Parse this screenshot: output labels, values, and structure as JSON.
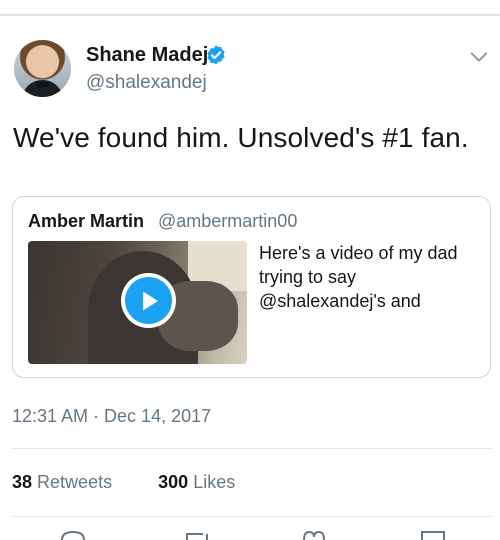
{
  "tweet": {
    "author": {
      "name": "Shane Madej",
      "handle": "@shalexandej",
      "verified": true
    },
    "text": "We've found him. Unsolved's #1 fan.",
    "quoted_tweet": {
      "author_name": "Amber Martin",
      "author_handle": "@ambermartin00",
      "text_lines": [
        "Here's a video of my dad",
        "trying to say",
        "@shalexandej's and"
      ],
      "media": "video"
    },
    "timestamp": "12:31 AM · Dec 14, 2017",
    "stats": {
      "retweets_count": "38",
      "retweets_label": "Retweets",
      "likes_count": "300",
      "likes_label": "Likes"
    }
  },
  "icons": {
    "verified": "verified-badge-icon",
    "menu": "chevron-down-icon",
    "play": "play-icon",
    "actions": [
      "reply-icon",
      "retweet-icon",
      "like-icon",
      "share-icon"
    ]
  },
  "colors": {
    "accent": "#1da1f2",
    "text": "#14171a",
    "secondary": "#657786",
    "border": "#ccd6dd"
  }
}
